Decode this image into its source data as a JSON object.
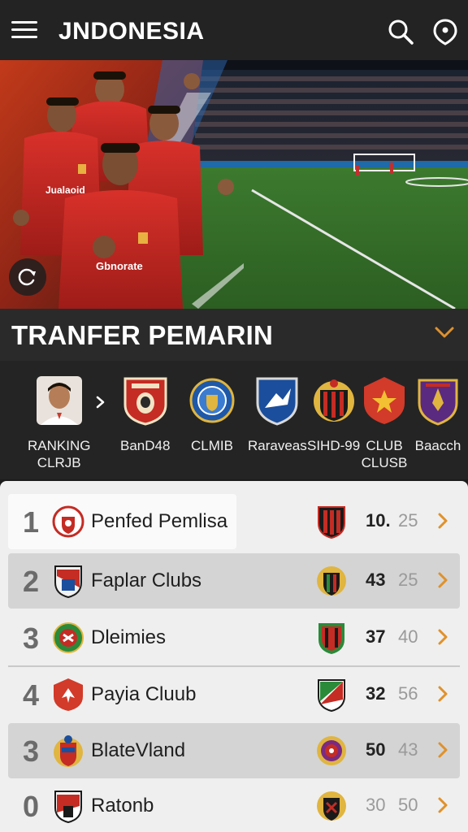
{
  "header": {
    "title": "JNDONESIA",
    "menu_icon": "hamburger-menu-icon",
    "search_icon": "search-icon",
    "pin_icon": "location-pin-icon"
  },
  "hero": {
    "image": "national-team-players-and-stadium",
    "refresh_icon": "refresh-icon"
  },
  "section": {
    "title": "TRANFER PEMARIN",
    "toggle_icon": "chevron-down-icon"
  },
  "clubs": [
    {
      "label": "RANKING\nCLRJB",
      "logo": "player-avatar"
    },
    {
      "label": "BanD48",
      "logo": "red-shield-crest"
    },
    {
      "label": "CLMIB",
      "logo": "blue-round-crest"
    },
    {
      "label": "Raraveas",
      "logo": "blue-shield-crest"
    },
    {
      "label": "SIHD-99",
      "logo": "gold-striped-crest"
    },
    {
      "label": "CLUB\nCLUSB",
      "logo": "red-star-shield"
    },
    {
      "label": "Baacch",
      "logo": "purple-gold-crest"
    }
  ],
  "ranking": [
    {
      "rank": "1",
      "name": "Penfed Pemlisa",
      "v1": "10.",
      "v2": "25"
    },
    {
      "rank": "2",
      "name": "Faplar Clubs",
      "v1": "43",
      "v2": "25"
    },
    {
      "rank": "3",
      "name": "Dleimies",
      "v1": "37",
      "v2": "40"
    },
    {
      "rank": "4",
      "name": "Payia Cluub",
      "v1": "32",
      "v2": "56"
    },
    {
      "rank": "3",
      "name": "BlateVland",
      "v1": "50",
      "v2": "43"
    },
    {
      "rank": "0",
      "name": "Ratonb",
      "v1": "30",
      "v2": "50"
    }
  ],
  "colors": {
    "accent": "#e0912b",
    "header_bg": "#232323",
    "panel_bg": "#efefef",
    "row_highlight": "#d4d4d4"
  }
}
